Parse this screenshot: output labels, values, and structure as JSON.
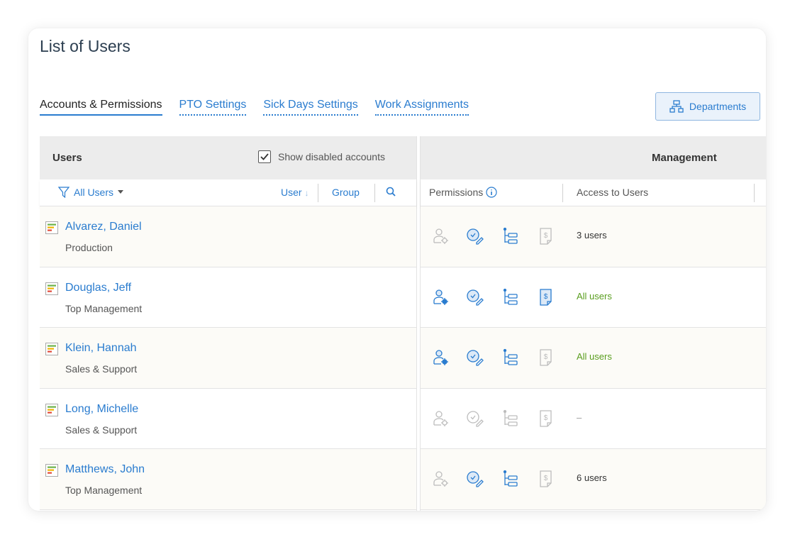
{
  "page": {
    "title": "List of Users"
  },
  "tabs": [
    {
      "label": "Accounts & Permissions",
      "active": true
    },
    {
      "label": "PTO Settings",
      "active": false
    },
    {
      "label": "Sick Days Settings",
      "active": false
    },
    {
      "label": "Work Assignments",
      "active": false
    }
  ],
  "departments_button": {
    "label": "Departments"
  },
  "users_panel": {
    "title": "Users",
    "show_disabled_label": "Show disabled accounts",
    "show_disabled_checked": true,
    "filter_label": "All Users",
    "sort_user_label": "User",
    "sort_group_label": "Group"
  },
  "management_panel": {
    "title": "Management",
    "permissions_label": "Permissions",
    "access_label": "Access to Users"
  },
  "colors": {
    "accent": "#2a7ccf",
    "green": "#5a9e1f",
    "muted": "#bdbdbd"
  },
  "users": [
    {
      "name": "Alvarez, Daniel",
      "department": "Production",
      "perm": [
        false,
        true,
        true,
        false
      ],
      "access": "3 users",
      "access_color": "#333333"
    },
    {
      "name": "Douglas, Jeff",
      "department": "Top Management",
      "perm": [
        true,
        true,
        true,
        true
      ],
      "access": "All users",
      "access_color": "#5a9e1f"
    },
    {
      "name": "Klein, Hannah",
      "department": "Sales & Support",
      "perm": [
        true,
        true,
        true,
        false
      ],
      "access": "All users",
      "access_color": "#5a9e1f"
    },
    {
      "name": "Long, Michelle",
      "department": "Sales & Support",
      "perm": [
        false,
        false,
        false,
        false
      ],
      "access": "–",
      "access_color": "#999999"
    },
    {
      "name": "Matthews, John",
      "department": "Top Management",
      "perm": [
        false,
        true,
        true,
        false
      ],
      "access": "6 users",
      "access_color": "#333333"
    }
  ],
  "permission_icons": [
    "user-gear-icon",
    "clock-edit-icon",
    "tree-structure-icon",
    "billing-document-icon"
  ]
}
